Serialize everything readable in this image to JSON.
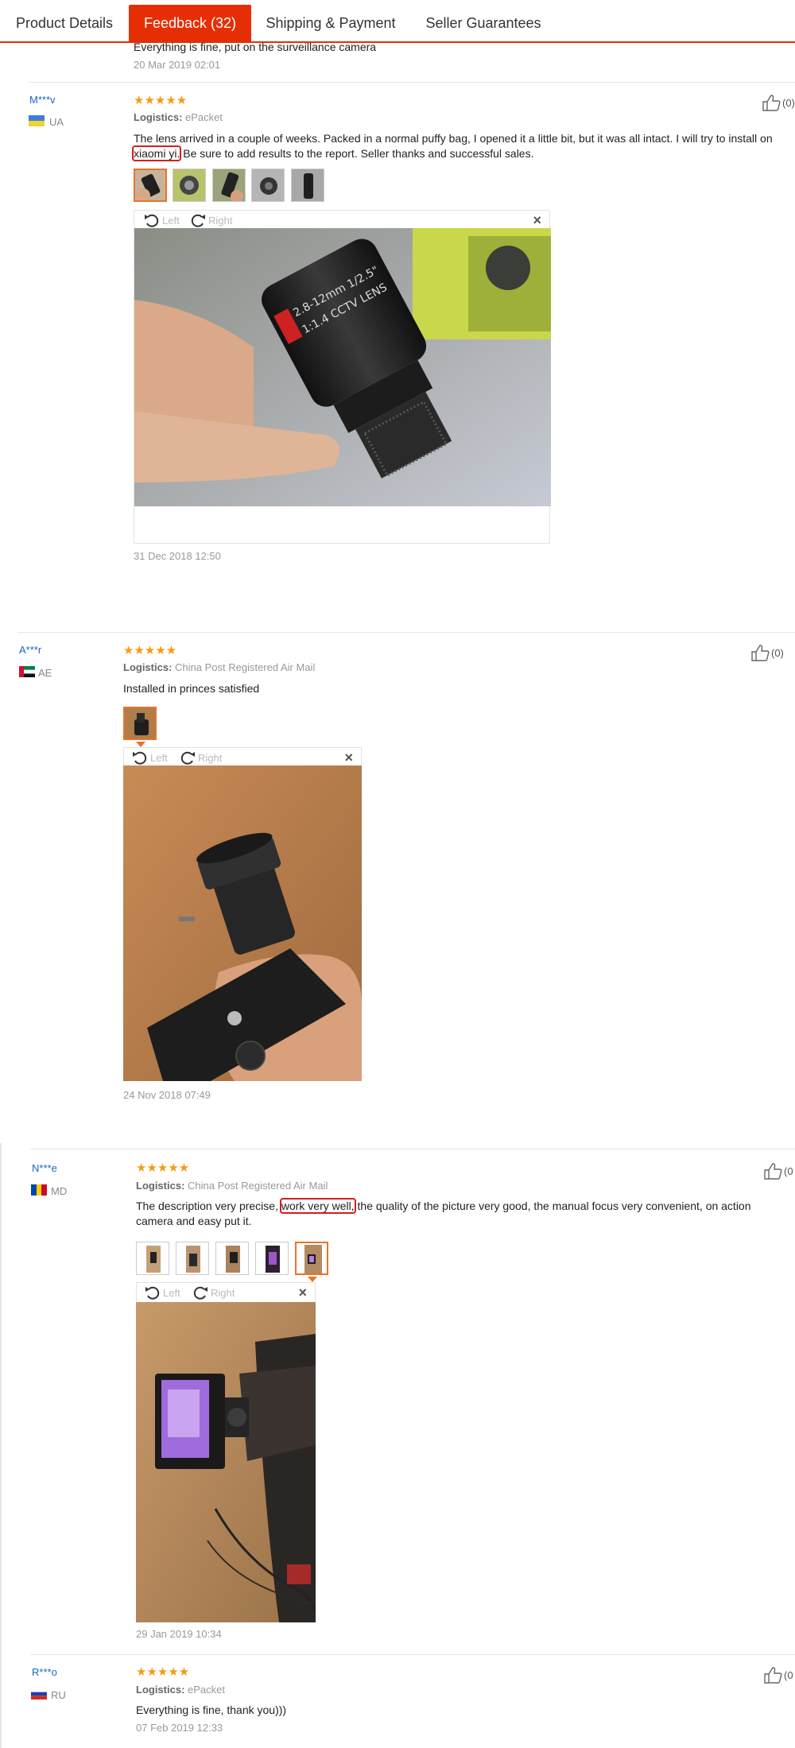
{
  "tabs": [
    {
      "label": "Product Details"
    },
    {
      "label": "Feedback (32)"
    },
    {
      "label": "Shipping & Payment"
    },
    {
      "label": "Seller Guarantees"
    }
  ],
  "accent_color": "#e62e04",
  "star_color": "#f39c12",
  "highlight_color": "#d21f1f",
  "prev_review": {
    "text": "Everything is fine, put on the surveillance camera",
    "date": "20 Mar 2019 02:01"
  },
  "viewer_labels": {
    "left": "Left",
    "right": "Right",
    "close": "×"
  },
  "reviews": [
    {
      "user": "M***v",
      "country": "UA",
      "stars": "★★★★★",
      "logistics_label": "Logistics:",
      "logistics": "ePacket",
      "text_before": "The lens arrived in a couple of weeks. Packed in a normal puffy bag, I opened it a little bit, but it was all intact. I will try to install on ",
      "text_highlight": "xiaomi yi.",
      "text_after": " Be sure to add results to the report. Seller thanks and successful sales.",
      "date": "31 Dec 2018 12:50",
      "likes": "(0)",
      "photo_count": 5,
      "selected_photo": 1
    },
    {
      "user": "A***r",
      "country": "AE",
      "stars": "★★★★★",
      "logistics_label": "Logistics:",
      "logistics": "China Post Registered Air Mail",
      "text_before": "Installed in princes satisfied",
      "text_highlight": "",
      "text_after": "",
      "date": "24 Nov 2018 07:49",
      "likes": "(0)",
      "photo_count": 1,
      "selected_photo": 1
    },
    {
      "user": "N***e",
      "country": "MD",
      "stars": "★★★★★",
      "logistics_label": "Logistics:",
      "logistics": "China Post Registered Air Mail",
      "text_before": "The description very precise, ",
      "text_highlight": "work very well,",
      "text_after": " the quality of the picture very good, the manual focus very convenient, on action camera and easy put it.",
      "date": "29 Jan 2019 10:34",
      "likes": "(0",
      "photo_count": 5,
      "selected_photo": 5
    },
    {
      "user": "R***o",
      "country": "RU",
      "stars": "★★★★★",
      "logistics_label": "Logistics:",
      "logistics": "ePacket",
      "text_before": "Everything is fine, thank you)))",
      "text_highlight": "",
      "text_after": "",
      "date": "07 Feb 2019 12:33",
      "likes": "(0",
      "photo_count": 0,
      "selected_photo": 0
    }
  ]
}
